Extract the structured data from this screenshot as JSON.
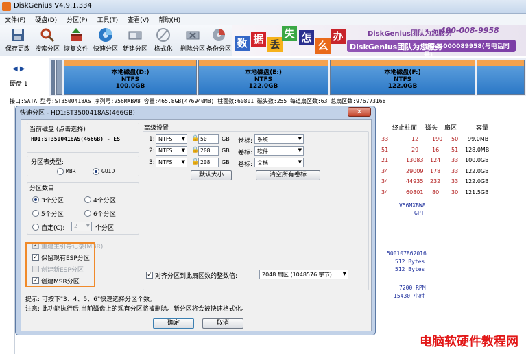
{
  "window": {
    "title": "DiskGenius V4.9.1.334"
  },
  "menu": [
    "文件(F)",
    "硬盘(D)",
    "分区(P)",
    "工具(T)",
    "查看(V)",
    "帮助(H)"
  ],
  "toolbar": [
    "保存更改",
    "搜索分区",
    "恢复文件",
    "快速分区",
    "新建分区",
    "格式化",
    "删除分区",
    "备份分区"
  ],
  "banner": {
    "chars": [
      "数",
      "据",
      "丢",
      "失",
      "怎",
      "么",
      "办"
    ],
    "strip_brand": "DiskGenius团队为您服务",
    "strip_qq": "QQ: 4000089958(与电话同号)",
    "line1": "DiskGenius团队为您服务",
    "phone": "400-008-9958"
  },
  "diskmap": {
    "nav": "◀ ▶",
    "disk_label": "硬盘 1",
    "partitions": [
      {
        "name": "本地磁盘(D:)",
        "fs": "NTFS",
        "size": "100.0GB"
      },
      {
        "name": "本地磁盘(E:)",
        "fs": "NTFS",
        "size": "122.0GB"
      },
      {
        "name": "本地磁盘(F:)",
        "fs": "NTFS",
        "size": "122.0GB"
      }
    ]
  },
  "infoline": "接口:SATA  型号:ST3500418AS  序列号:V56MXBW8  容量:465.8GB(476940MB)  柱面数:60801  磁头数:255  每道扇区数:63  总扇区数:976773168",
  "right": {
    "headers": [
      "终止柱面",
      "磁头",
      "扇区",
      "容量"
    ],
    "rows": [
      {
        "a": "33",
        "b": "12",
        "c": "190",
        "d": "50",
        "e": "99.0MB"
      },
      {
        "a": "51",
        "b": "29",
        "c": "16",
        "d": "51",
        "e": "128.0MB"
      },
      {
        "a": "21",
        "b": "13083",
        "c": "124",
        "d": "33",
        "e": "100.0GB"
      },
      {
        "a": "34",
        "b": "29009",
        "c": "178",
        "d": "33",
        "e": "122.0GB"
      },
      {
        "a": "34",
        "b": "44935",
        "c": "232",
        "d": "33",
        "e": "122.0GB"
      },
      {
        "a": "34",
        "b": "60801",
        "c": "80",
        "d": "30",
        "e": "121.5GB"
      }
    ],
    "details": [
      "V56MXBW8",
      "GPT",
      "500107862016",
      "512 Bytes",
      "512 Bytes",
      "7200 RPM",
      "15430 小时"
    ]
  },
  "dialog": {
    "title": "快速分区 - HD1:ST3500418AS(466GB)",
    "close": "✕",
    "current_disk_label": "当前磁盘 (点击选择)",
    "current_disk_value": "HD1:ST3500418AS(466GB) - ES",
    "table_type_label": "分区表类型:",
    "mbr": "MBR",
    "guid": "GUID",
    "count_label": "分区数目",
    "count_options": [
      "3个分区",
      "4个分区",
      "5个分区",
      "6个分区"
    ],
    "custom_label": "自定(C):",
    "custom_value": "2",
    "custom_suffix": "个分区",
    "rebuild_mbr": "重建主引导记录(MBR)",
    "keep_esp": "保留现有ESP分区",
    "create_esp": "创建新ESP分区",
    "create_msr": "创建MSR分区",
    "advanced_label": "高级设置",
    "adv_rows": [
      {
        "idx": "1:",
        "fs": "NTFS",
        "size": "50",
        "unit": "GB",
        "vol_label": "卷标:",
        "vol": "系统"
      },
      {
        "idx": "2:",
        "fs": "NTFS",
        "size": "208",
        "unit": "GB",
        "vol_label": "卷标:",
        "vol": "软件"
      },
      {
        "idx": "3:",
        "fs": "NTFS",
        "size": "208",
        "unit": "GB",
        "vol_label": "卷标:",
        "vol": "文档"
      }
    ],
    "default_size": "默认大小",
    "clear_labels": "清空所有卷标",
    "align_label": "对齐分区到此扇区数的整数倍:",
    "align_value": "2048 扇区 (1048576 字节)",
    "hint": "提示: 可按下\"3、4、5、6\"快速选择分区个数。",
    "note": "注意: 此功能执行后,当前磁盘上的现有分区将被删除。新分区将会被快速格式化。",
    "ok": "确定",
    "cancel": "取消"
  },
  "watermark": "电脑软硬件教程网"
}
